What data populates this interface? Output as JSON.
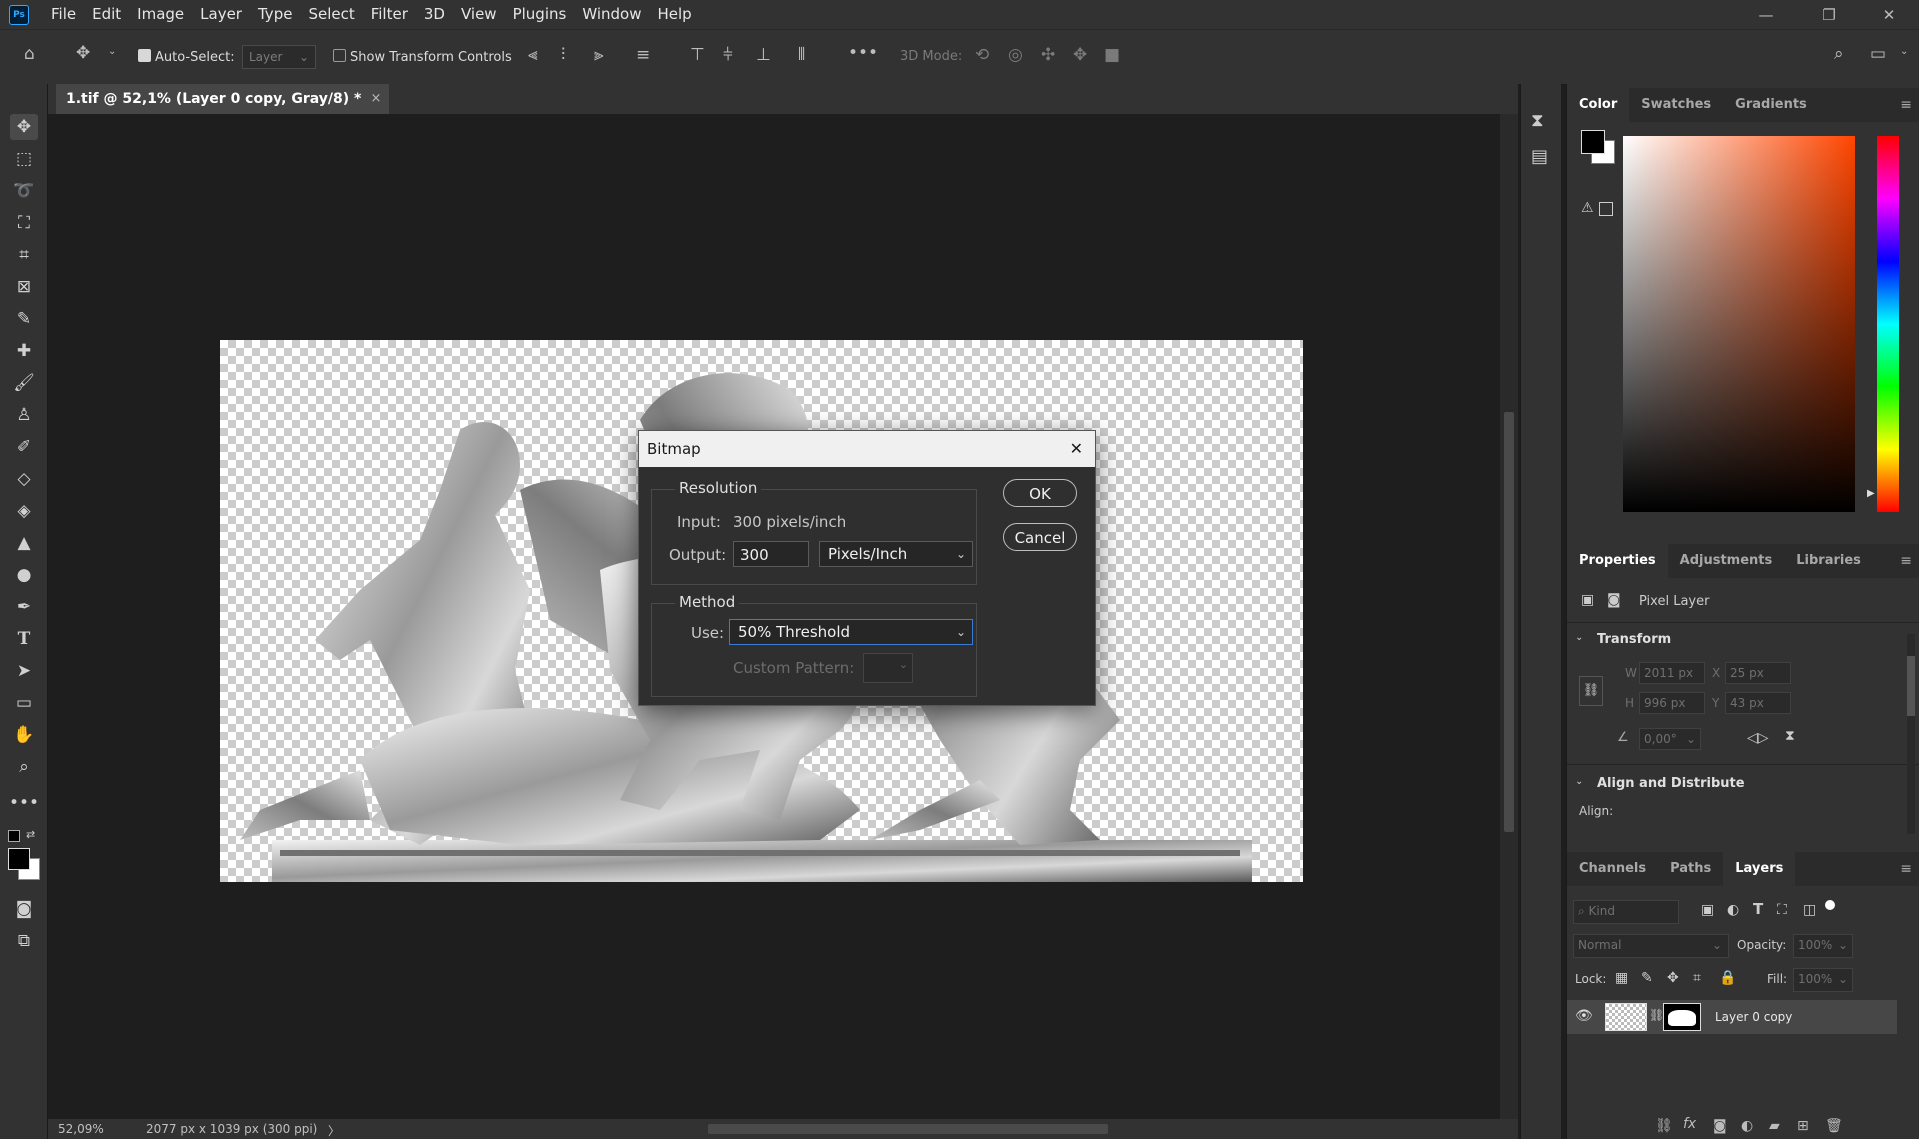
{
  "app": {
    "logo": "Ps"
  },
  "menu": [
    "File",
    "Edit",
    "Image",
    "Layer",
    "Type",
    "Select",
    "Filter",
    "3D",
    "View",
    "Plugins",
    "Window",
    "Help"
  ],
  "window_controls": {
    "minimize": "—",
    "restore": "❐",
    "close": "✕"
  },
  "options": {
    "auto_select_label": "Auto-Select:",
    "auto_select_value": "Layer",
    "show_transform_label": "Show Transform Controls",
    "mode_3d_label": "3D Mode:"
  },
  "document": {
    "tab_title": "1.tif @ 52,1% (Layer 0 copy, Gray/8) *",
    "tab_close": "×"
  },
  "status": {
    "zoom": "52,09%",
    "info": "2077 px x 1039 px (300 ppi)",
    "arrow": "〉"
  },
  "color_panel": {
    "tabs": [
      "Color",
      "Swatches",
      "Gradients"
    ],
    "active": "Color"
  },
  "properties_panel": {
    "tabs": [
      "Properties",
      "Adjustments",
      "Libraries"
    ],
    "layer_kind": "Pixel Layer",
    "transform_title": "Transform",
    "w_label": "W",
    "w_value": "2011 px",
    "h_label": "H",
    "h_value": "996 px",
    "x_label": "X",
    "x_value": "25 px",
    "y_label": "Y",
    "y_value": "43 px",
    "angle_value": "0,00°",
    "align_title": "Align and Distribute",
    "align_label": "Align:"
  },
  "layers_panel": {
    "tabs": [
      "Channels",
      "Paths",
      "Layers"
    ],
    "kind_placeholder": "Kind",
    "blend_mode": "Normal",
    "opacity_label": "Opacity:",
    "opacity_value": "100%",
    "lock_label": "Lock:",
    "fill_label": "Fill:",
    "fill_value": "100%",
    "layers": [
      {
        "name": "Layer 0 copy",
        "visible": true
      }
    ]
  },
  "dialog": {
    "title": "Bitmap",
    "close": "✕",
    "resolution_title": "Resolution",
    "input_label": "Input:",
    "input_value": "300 pixels/inch",
    "output_label": "Output:",
    "output_value": "300",
    "output_unit": "Pixels/Inch",
    "method_title": "Method",
    "use_label": "Use:",
    "use_value": "50% Threshold",
    "custom_pattern_label": "Custom Pattern:",
    "ok_label": "OK",
    "cancel_label": "Cancel"
  },
  "colors": {
    "accent": "#31a8ff",
    "panel_bg": "#323232",
    "canvas_bg": "#1e1e1e",
    "foreground_swatch": "#000000",
    "background_swatch": "#ffffff"
  }
}
